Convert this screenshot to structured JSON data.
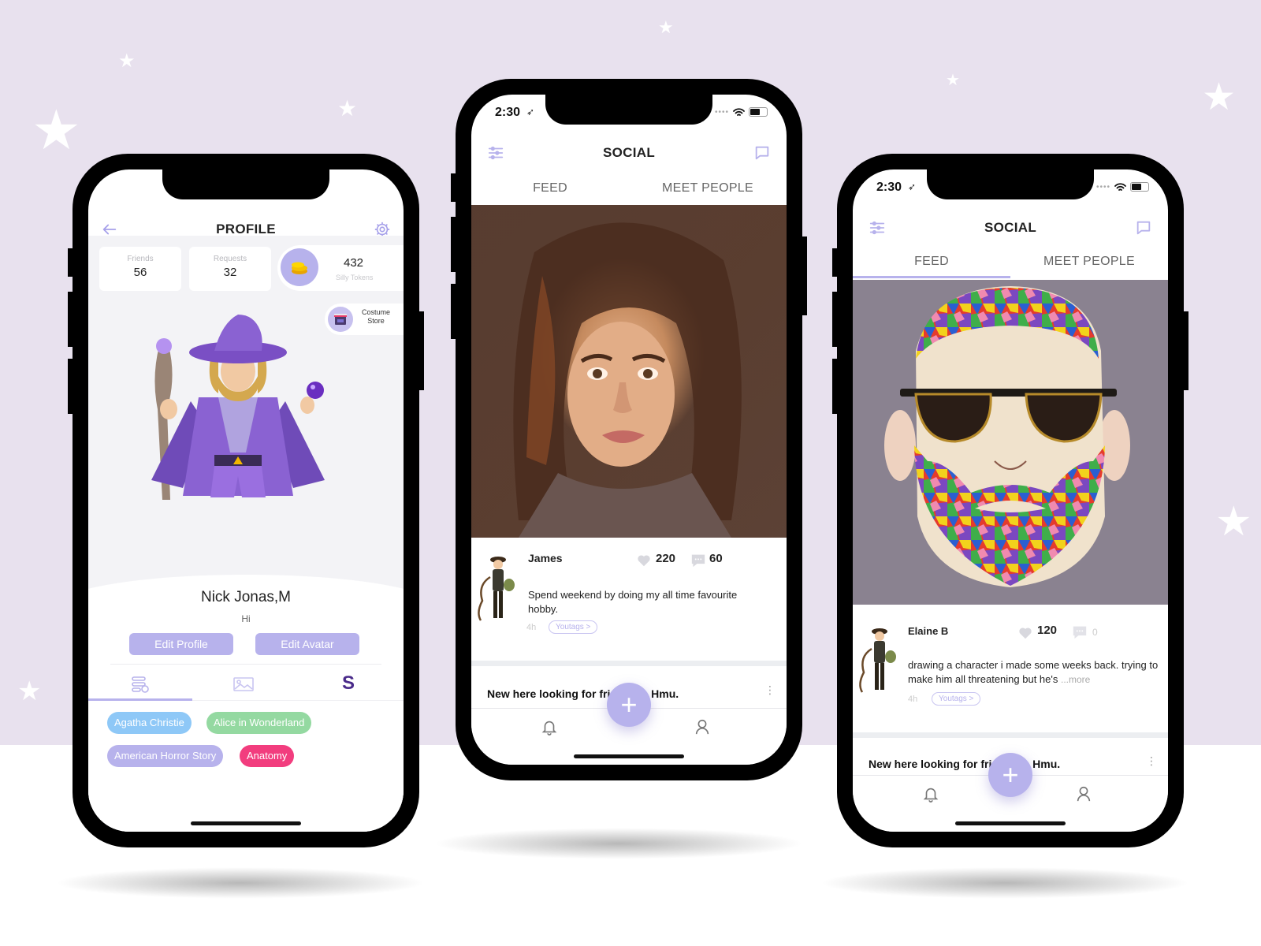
{
  "colors": {
    "background": "#e8e1ee",
    "accent": "#b7b2ec",
    "tag_blue": "#8ec8f7",
    "tag_green": "#94d9a1",
    "tag_purple": "#b7b2ec",
    "tag_pink": "#f23d7e"
  },
  "profile_phone": {
    "header": {
      "title": "PROFILE",
      "back_icon": "back-arrow-icon",
      "settings_icon": "gear-icon"
    },
    "stats": [
      {
        "label": "Friends",
        "value": "56"
      },
      {
        "label": "Requests",
        "value": "32"
      }
    ],
    "tokens": {
      "value": "432",
      "label": "Silly Tokens",
      "icon": "gold-coins-icon"
    },
    "costume_store": {
      "line1": "Costume",
      "line2": "Store",
      "icon": "store-icon"
    },
    "avatar": "wizard-avatar",
    "user": {
      "name": "Nick Jonas,M",
      "bio": "Hi"
    },
    "buttons": {
      "edit_profile": "Edit Profile",
      "edit_avatar": "Edit Avatar"
    },
    "tabs": [
      {
        "icon": "list-settings-icon",
        "active": true
      },
      {
        "icon": "image-icon",
        "active": false
      },
      {
        "icon": "s-logo-icon",
        "label": "S",
        "active": false
      }
    ],
    "interests": [
      {
        "label": "Agatha Christie",
        "color": "#8ec8f7"
      },
      {
        "label": "Alice in Wonderland",
        "color": "#94d9a1"
      },
      {
        "label": "American Horror Story",
        "color": "#b7b2ec"
      },
      {
        "label": "Anatomy",
        "color": "#f23d7e"
      }
    ]
  },
  "social_phone_1": {
    "status": {
      "time": "2:30"
    },
    "header": {
      "title": "SOCIAL",
      "filter_icon": "sliders-icon",
      "chat_icon": "chat-bubble-icon"
    },
    "tabs": [
      {
        "label": "FEED",
        "active": false
      },
      {
        "label": "MEET PEOPLE",
        "active": false
      }
    ],
    "post": {
      "image": "painted-portrait-woman",
      "author": "James",
      "likes": "220",
      "comments": "60",
      "text": "Spend weekend by doing my all time favourite hobby.",
      "time": "4h",
      "youtags": "Youtags >"
    },
    "next_post": {
      "text_start": "New here looking for frie",
      "text_end": "Hmu."
    },
    "nav": {
      "left_icon": "bell-icon",
      "fab": "+",
      "right_icon": "user-icon"
    }
  },
  "social_phone_2": {
    "status": {
      "time": "2:30"
    },
    "header": {
      "title": "SOCIAL",
      "filter_icon": "sliders-icon",
      "chat_icon": "chat-bubble-icon"
    },
    "tabs": [
      {
        "label": "FEED",
        "active": true
      },
      {
        "label": "MEET PEOPLE",
        "active": false
      }
    ],
    "post": {
      "image": "mosaic-bearded-man-painting",
      "author": "Elaine B",
      "likes": "120",
      "comments": "0",
      "text": "drawing a character i made some weeks back. trying to make him all threatening but he's",
      "more": "...more",
      "time": "4h",
      "youtags": "Youtags >"
    },
    "next_post": {
      "text_start": "New here looking for frie",
      "text_end": "Hmu."
    },
    "nav": {
      "left_icon": "bell-icon",
      "fab": "+",
      "right_icon": "user-icon"
    }
  }
}
